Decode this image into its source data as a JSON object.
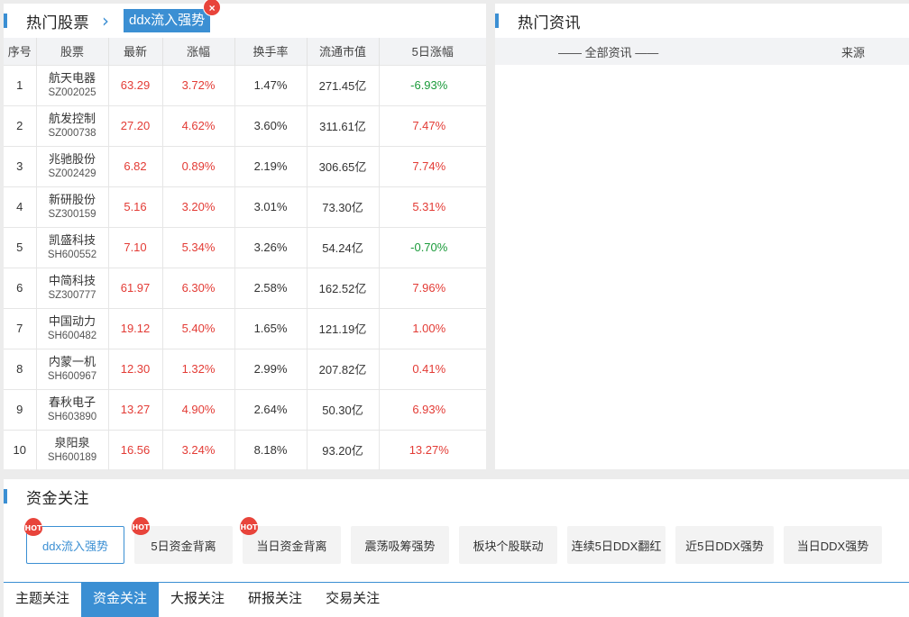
{
  "hot_stocks": {
    "title": "热门股票",
    "crumb_tag": "ddx流入强势",
    "crumb_close": "×",
    "columns": [
      "序号",
      "股票",
      "最新",
      "涨幅",
      "换手率",
      "流通市值",
      "5日涨幅"
    ],
    "rows": [
      {
        "idx": "1",
        "name": "航天电器",
        "code": "SZ002025",
        "price": "63.29",
        "change": "3.72%",
        "turnover": "1.47%",
        "cap": "271.45亿",
        "change5": "-6.93%"
      },
      {
        "idx": "2",
        "name": "航发控制",
        "code": "SZ000738",
        "price": "27.20",
        "change": "4.62%",
        "turnover": "3.60%",
        "cap": "311.61亿",
        "change5": "7.47%"
      },
      {
        "idx": "3",
        "name": "兆驰股份",
        "code": "SZ002429",
        "price": "6.82",
        "change": "0.89%",
        "turnover": "2.19%",
        "cap": "306.65亿",
        "change5": "7.74%"
      },
      {
        "idx": "4",
        "name": "新研股份",
        "code": "SZ300159",
        "price": "5.16",
        "change": "3.20%",
        "turnover": "3.01%",
        "cap": "73.30亿",
        "change5": "5.31%"
      },
      {
        "idx": "5",
        "name": "凯盛科技",
        "code": "SH600552",
        "price": "7.10",
        "change": "5.34%",
        "turnover": "3.26%",
        "cap": "54.24亿",
        "change5": "-0.70%"
      },
      {
        "idx": "6",
        "name": "中简科技",
        "code": "SZ300777",
        "price": "61.97",
        "change": "6.30%",
        "turnover": "2.58%",
        "cap": "162.52亿",
        "change5": "7.96%"
      },
      {
        "idx": "7",
        "name": "中国动力",
        "code": "SH600482",
        "price": "19.12",
        "change": "5.40%",
        "turnover": "1.65%",
        "cap": "121.19亿",
        "change5": "1.00%"
      },
      {
        "idx": "8",
        "name": "内蒙一机",
        "code": "SH600967",
        "price": "12.30",
        "change": "1.32%",
        "turnover": "2.99%",
        "cap": "207.82亿",
        "change5": "0.41%"
      },
      {
        "idx": "9",
        "name": "春秋电子",
        "code": "SH603890",
        "price": "13.27",
        "change": "4.90%",
        "turnover": "2.64%",
        "cap": "50.30亿",
        "change5": "6.93%"
      },
      {
        "idx": "10",
        "name": "泉阳泉",
        "code": "SH600189",
        "price": "16.56",
        "change": "3.24%",
        "turnover": "8.18%",
        "cap": "93.20亿",
        "change5": "13.27%"
      }
    ]
  },
  "hot_news": {
    "title": "热门资讯",
    "col_all": "—— 全部资讯 ——",
    "col_source": "来源"
  },
  "fund_focus": {
    "title": "资金关注",
    "hot_badge": "HOT",
    "tags": [
      {
        "label": "ddx流入强势",
        "hot": true,
        "active": true
      },
      {
        "label": "5日资金背离",
        "hot": true,
        "active": false
      },
      {
        "label": "当日资金背离",
        "hot": true,
        "active": false
      },
      {
        "label": "震荡吸筹强势",
        "hot": false,
        "active": false
      },
      {
        "label": "板块个股联动",
        "hot": false,
        "active": false
      },
      {
        "label": "连续5日DDX翻红",
        "hot": false,
        "active": false
      },
      {
        "label": "近5日DDX强势",
        "hot": false,
        "active": false
      },
      {
        "label": "当日DDX强势",
        "hot": false,
        "active": false
      }
    ],
    "tabs": [
      {
        "label": "主题关注",
        "active": false
      },
      {
        "label": "资金关注",
        "active": true
      },
      {
        "label": "大报关注",
        "active": false
      },
      {
        "label": "研报关注",
        "active": false
      },
      {
        "label": "交易关注",
        "active": false
      }
    ]
  },
  "colors": {
    "accent": "#3b8fd3",
    "up": "#e33b35",
    "down": "#1a9a3a"
  }
}
